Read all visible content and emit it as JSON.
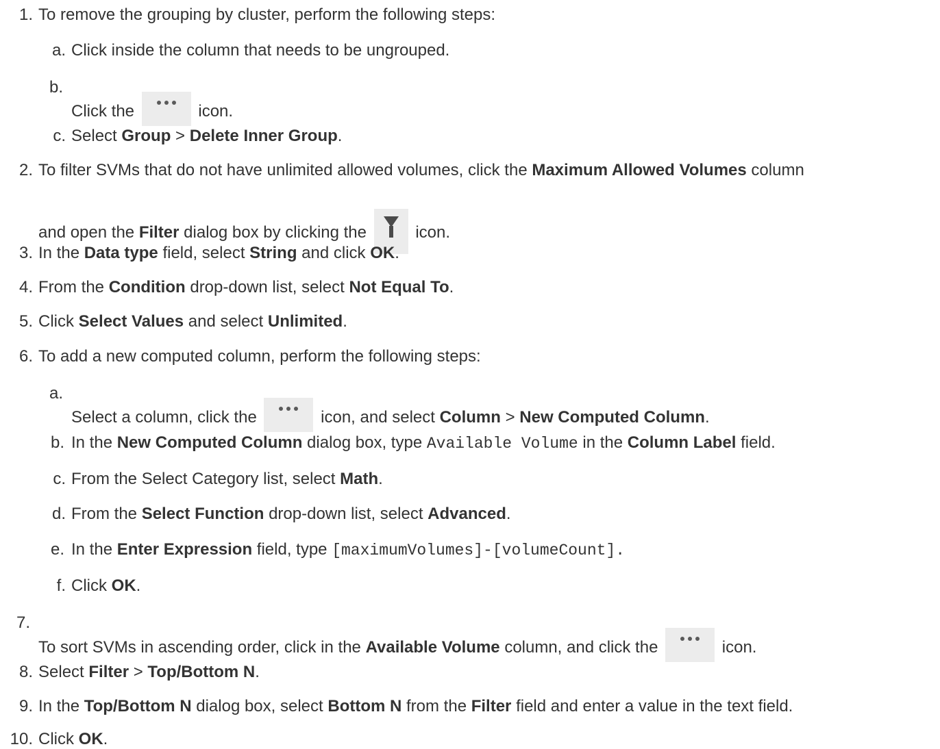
{
  "steps": [
    {
      "num": "1.",
      "text": "To remove the grouping by cluster, perform the following steps:"
    },
    {
      "sub": [
        {
          "num": "a.",
          "text": "Click inside the column that needs to be ungrouped."
        },
        {
          "num": "b.",
          "before": "Click the",
          "after": "icon."
        },
        {
          "num": "c.",
          "before": "Select",
          "b1": "Group",
          "mid": ">",
          "b2": "Delete Inner Group",
          "end": "."
        }
      ]
    },
    {
      "num": "2.",
      "line1_before": "To filter SVMs that do not have unlimited allowed volumes, click the",
      "line1_bold": "Maximum Allowed Volumes",
      "line1_after": "column",
      "line2_before": "and open the",
      "line2_bold": "Filter",
      "line2_mid": "dialog box by clicking the",
      "line2_after": "icon."
    },
    {
      "num": "3.",
      "t1": "In the",
      "b1": "Data type",
      "t2": "field, select",
      "b2": "String",
      "t3": "and click",
      "b3": "OK",
      "t4": "."
    },
    {
      "num": "4.",
      "t1": "From the",
      "b1": "Condition",
      "t2": "drop-down list, select",
      "b2": "Not Equal To",
      "t3": "."
    },
    {
      "num": "5.",
      "t1": "Click",
      "b1": "Select Values",
      "t2": "and select",
      "b2": "Unlimited",
      "t3": "."
    },
    {
      "num": "6.",
      "text": "To add a new computed column, perform the following steps:"
    },
    {
      "sub": [
        {
          "num": "a.",
          "t1": "Select a column, click the",
          "t2": "icon, and select",
          "b1": "Column",
          "mid": ">",
          "b2": "New Computed Column",
          "end": "."
        },
        {
          "num": "b.",
          "t1": "In the",
          "b1": "New Computed Column",
          "t2": "dialog box, type",
          "code": "Available Volume",
          "t3": "in the",
          "b2": "Column Label",
          "t4": "field."
        },
        {
          "num": "c.",
          "t1": "From the Select Category list, select",
          "b1": "Math",
          "t2": "."
        },
        {
          "num": "d.",
          "t1": "From the",
          "b1": "Select Function",
          "t2": "drop-down list, select",
          "b2": "Advanced",
          "t3": "."
        },
        {
          "num": "e.",
          "t1": "In the",
          "b1": "Enter Expression",
          "t2": "field, type",
          "code": "[maximumVolumes]-[volumeCount]."
        },
        {
          "num": "f.",
          "t1": "Click",
          "b1": "OK",
          "t2": "."
        }
      ]
    },
    {
      "num": "7.",
      "t1": "To sort SVMs in ascending order, click in the",
      "b1": "Available Volume",
      "t2": "column, and click the",
      "t3": "icon."
    },
    {
      "num": "8.",
      "t1": "Select",
      "b1": "Filter",
      "mid": ">",
      "b2": "Top/Bottom N",
      "t2": "."
    },
    {
      "num": "9.",
      "t1": "In the",
      "b1": "Top/Bottom N",
      "t2": "dialog box, select",
      "b2": "Bottom N",
      "t3": "from the",
      "b3": "Filter",
      "t4": "field and enter a value in the text field."
    },
    {
      "num": "10.",
      "t1": "Click",
      "b1": "OK",
      "t2": "."
    }
  ],
  "icons": {
    "more": "more-options-icon",
    "filter": "filter-funnel-icon"
  },
  "colors": {
    "text": "#333333",
    "icon_bg": "#ececec"
  }
}
